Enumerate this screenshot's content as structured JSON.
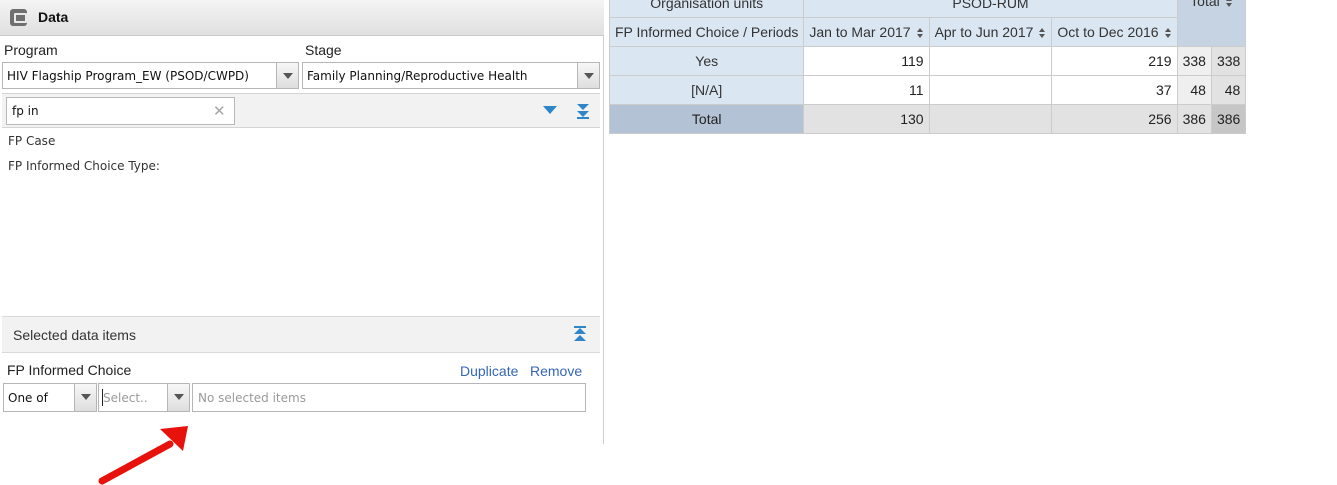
{
  "panel": {
    "title": "Data",
    "program_label": "Program",
    "program_value": "HIV Flagship Program_EW (PSOD/CWPD)",
    "stage_label": "Stage",
    "stage_value": "Family Planning/Reproductive Health",
    "search_value": "fp in",
    "available_items": [
      "FP Case",
      "FP Informed Choice Type:"
    ],
    "selected_title": "Selected data items",
    "selected_item": {
      "name": "FP Informed Choice",
      "duplicate_label": "Duplicate",
      "remove_label": "Remove",
      "operator": "One of",
      "value_placeholder": "Select..",
      "selected_placeholder": "No selected items"
    }
  },
  "table": {
    "col_group_label": "Organisation units",
    "col_group_value": "PSOD-RUM",
    "total_label": "Total",
    "row_dim_label": "FP Informed Choice / Periods",
    "periods": [
      "Jan to Mar 2017",
      "Apr to Jun 2017",
      "Oct to Dec 2016"
    ],
    "rows": [
      {
        "label": "Yes",
        "values": [
          "119",
          "",
          "219"
        ],
        "subtotal": "338",
        "total": "338"
      },
      {
        "label": "[N/A]",
        "values": [
          "11",
          "",
          "37"
        ],
        "subtotal": "48",
        "total": "48"
      }
    ],
    "total_row": {
      "label": "Total",
      "values": [
        "130",
        "",
        "256"
      ],
      "subtotal": "386",
      "total": "386"
    }
  },
  "colors": {
    "header_blue": "#dbe6f3",
    "link_blue": "#3566b8",
    "icon_blue": "#2e86c9",
    "annotation_red": "#e8120c"
  }
}
